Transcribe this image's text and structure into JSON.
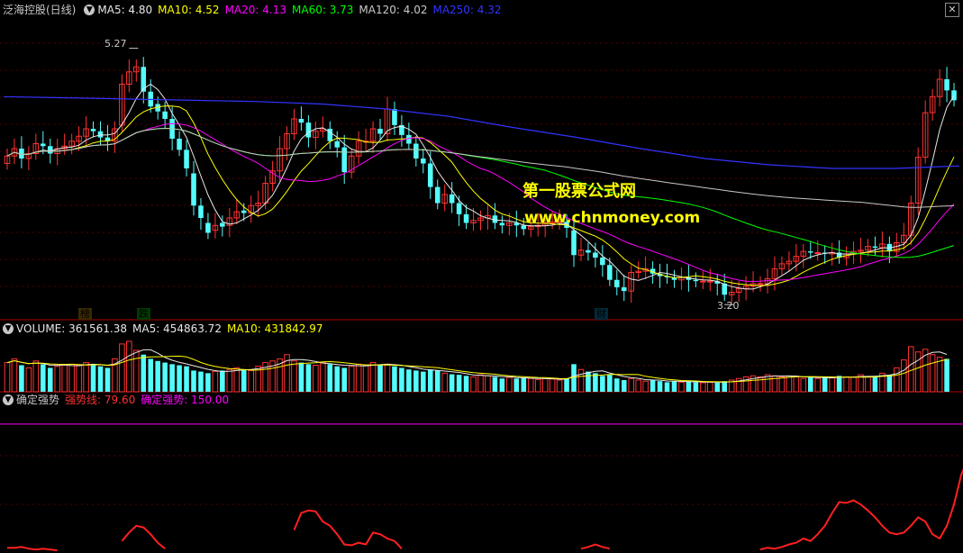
{
  "main_legend": {
    "title": "泛海控股(日线)",
    "items": [
      {
        "text": "MA5: 4.80",
        "color": "#e8e8e8"
      },
      {
        "text": "MA10: 4.52",
        "color": "#ffff00"
      },
      {
        "text": "MA20: 4.13",
        "color": "#ff00ff"
      },
      {
        "text": "MA60: 3.73",
        "color": "#00ff00"
      },
      {
        "text": "MA120: 4.02",
        "color": "#c8c8c8"
      },
      {
        "text": "MA250: 4.32",
        "color": "#3333ff"
      }
    ]
  },
  "volume_legend": {
    "items": [
      {
        "text": "VOLUME: 361561.38",
        "color": "#e8e8e8"
      },
      {
        "text": "MA5: 454863.72",
        "color": "#e8e8e8"
      },
      {
        "text": "MA10: 431842.97",
        "color": "#ffff00"
      }
    ]
  },
  "indicator_legend": {
    "title": "确定强势",
    "items": [
      {
        "text": "强势线: 79.60",
        "color": "#ff3030"
      },
      {
        "text": "确定强势: 150.00",
        "color": "#ff00ff"
      }
    ]
  },
  "watermark": {
    "line1": "第一股票公式网",
    "line2": "www.chnmoney.com"
  },
  "annotations": {
    "high": "5.27",
    "low": "3.20"
  },
  "event_marks": [
    {
      "text": "榜",
      "color": "#ffa040"
    },
    {
      "text": "跌",
      "color": "#00ff00"
    },
    {
      "text": "财",
      "color": "#00ffff"
    }
  ],
  "chart_data": [
    {
      "type": "candlestick",
      "ylim": [
        3.1,
        5.5
      ],
      "grid": true,
      "closes": [
        4.4,
        4.46,
        4.38,
        4.42,
        4.5,
        4.48,
        4.42,
        4.46,
        4.48,
        4.52,
        4.56,
        4.62,
        4.6,
        4.55,
        4.52,
        4.62,
        4.98,
        5.08,
        5.12,
        4.92,
        4.8,
        4.76,
        4.7,
        4.54,
        4.45,
        4.3,
        4.0,
        3.9,
        3.78,
        3.84,
        3.83,
        3.9,
        3.95,
        3.94,
        4.0,
        4.02,
        4.18,
        4.28,
        4.46,
        4.58,
        4.7,
        4.67,
        4.55,
        4.6,
        4.62,
        4.52,
        4.47,
        4.27,
        4.4,
        4.52,
        4.52,
        4.62,
        4.58,
        4.78,
        4.65,
        4.57,
        4.5,
        4.38,
        4.34,
        4.15,
        4.02,
        4.09,
        4.02,
        3.93,
        3.86,
        3.88,
        3.9,
        3.92,
        3.86,
        3.84,
        3.86,
        3.84,
        3.81,
        3.83,
        3.84,
        3.86,
        3.87,
        3.87,
        3.82,
        3.6,
        3.64,
        3.62,
        3.58,
        3.52,
        3.4,
        3.34,
        3.31,
        3.46,
        3.47,
        3.49,
        3.45,
        3.43,
        3.42,
        3.4,
        3.42,
        3.4,
        3.39,
        3.39,
        3.39,
        3.37,
        3.28,
        3.3,
        3.33,
        3.35,
        3.37,
        3.37,
        3.41,
        3.49,
        3.53,
        3.55,
        3.59,
        3.63,
        3.62,
        3.62,
        3.61,
        3.62,
        3.58,
        3.61,
        3.63,
        3.64,
        3.67,
        3.66,
        3.69,
        3.63,
        3.7,
        3.76,
        4.02,
        4.39,
        4.75,
        4.88,
        5.02,
        4.93,
        4.85
      ],
      "opens": [
        4.34,
        4.4,
        4.46,
        4.38,
        4.42,
        4.5,
        4.48,
        4.42,
        4.46,
        4.48,
        4.52,
        4.56,
        4.62,
        4.6,
        4.55,
        4.52,
        4.65,
        4.98,
        5.08,
        5.12,
        4.92,
        4.82,
        4.76,
        4.7,
        4.54,
        4.45,
        4.26,
        4.0,
        3.86,
        3.8,
        3.86,
        3.84,
        3.9,
        3.96,
        3.94,
        4.0,
        4.02,
        4.18,
        4.28,
        4.46,
        4.58,
        4.7,
        4.67,
        4.55,
        4.6,
        4.62,
        4.52,
        4.47,
        4.27,
        4.4,
        4.52,
        4.52,
        4.62,
        4.58,
        4.78,
        4.65,
        4.57,
        4.5,
        4.38,
        4.34,
        4.15,
        4.02,
        4.09,
        4.02,
        3.93,
        3.86,
        3.88,
        3.9,
        3.92,
        3.86,
        3.84,
        3.86,
        3.84,
        3.81,
        3.83,
        3.84,
        3.86,
        3.87,
        3.87,
        3.8,
        3.6,
        3.64,
        3.62,
        3.58,
        3.52,
        3.4,
        3.34,
        3.31,
        3.46,
        3.47,
        3.49,
        3.45,
        3.43,
        3.42,
        3.4,
        3.42,
        3.4,
        3.39,
        3.39,
        3.39,
        3.37,
        3.28,
        3.3,
        3.33,
        3.35,
        3.37,
        3.37,
        3.41,
        3.49,
        3.53,
        3.55,
        3.59,
        3.63,
        3.62,
        3.62,
        3.61,
        3.62,
        3.58,
        3.61,
        3.63,
        3.64,
        3.67,
        3.66,
        3.69,
        3.63,
        3.7,
        3.76,
        4.02,
        4.39,
        4.75,
        4.88,
        5.02,
        4.93
      ],
      "high": 5.27,
      "low": 3.2,
      "ma_series": [
        {
          "name": "MA5",
          "color": "#e8e8e8"
        },
        {
          "name": "MA10",
          "color": "#ffff00"
        },
        {
          "name": "MA20",
          "color": "#ff00ff"
        },
        {
          "name": "MA60",
          "color": "#00ff00"
        },
        {
          "name": "MA120",
          "color": "#c8c8c8"
        },
        {
          "name": "MA250",
          "color": "#3333ff"
        }
      ],
      "ma250": [
        4.88,
        4.87,
        4.86,
        4.85,
        4.84,
        4.82,
        4.78,
        4.72,
        4.63,
        4.55,
        4.46,
        4.38,
        4.33,
        4.3,
        4.3,
        4.32
      ]
    },
    {
      "type": "bar",
      "series": [
        {
          "name": "VOLUME"
        },
        {
          "name": "MA5"
        },
        {
          "name": "MA10"
        }
      ],
      "values": [
        0.55,
        0.62,
        0.5,
        0.45,
        0.58,
        0.52,
        0.45,
        0.48,
        0.5,
        0.52,
        0.5,
        0.55,
        0.52,
        0.48,
        0.45,
        0.62,
        0.9,
        0.95,
        0.78,
        0.7,
        0.62,
        0.58,
        0.55,
        0.52,
        0.5,
        0.48,
        0.4,
        0.38,
        0.35,
        0.38,
        0.4,
        0.42,
        0.45,
        0.42,
        0.4,
        0.48,
        0.55,
        0.58,
        0.62,
        0.7,
        0.58,
        0.55,
        0.52,
        0.5,
        0.55,
        0.52,
        0.48,
        0.45,
        0.48,
        0.52,
        0.5,
        0.55,
        0.5,
        0.52,
        0.48,
        0.45,
        0.42,
        0.4,
        0.38,
        0.42,
        0.4,
        0.35,
        0.33,
        0.32,
        0.3,
        0.28,
        0.32,
        0.3,
        0.28,
        0.25,
        0.27,
        0.25,
        0.26,
        0.25,
        0.23,
        0.25,
        0.24,
        0.22,
        0.25,
        0.52,
        0.42,
        0.38,
        0.35,
        0.3,
        0.32,
        0.25,
        0.22,
        0.25,
        0.22,
        0.2,
        0.22,
        0.2,
        0.18,
        0.2,
        0.18,
        0.2,
        0.18,
        0.17,
        0.18,
        0.17,
        0.2,
        0.22,
        0.25,
        0.28,
        0.3,
        0.28,
        0.32,
        0.3,
        0.28,
        0.3,
        0.28,
        0.25,
        0.27,
        0.25,
        0.28,
        0.26,
        0.3,
        0.28,
        0.27,
        0.32,
        0.28,
        0.3,
        0.35,
        0.32,
        0.45,
        0.6,
        0.85,
        0.75,
        0.8,
        0.7,
        0.65,
        0.62
      ]
    },
    {
      "type": "line",
      "series": [
        {
          "name": "强势线"
        },
        {
          "name": "确定强势",
          "constant": 150.0
        }
      ],
      "ylim": [
        0,
        170
      ],
      "values": [
        4,
        4,
        5,
        3,
        2,
        3,
        2,
        1,
        0,
        0,
        0,
        0,
        0,
        0,
        0,
        0,
        12,
        22,
        30,
        28,
        20,
        10,
        3,
        0,
        0,
        0,
        0,
        0,
        0,
        0,
        0,
        0,
        0,
        0,
        0,
        0,
        0,
        0,
        0,
        0,
        25,
        45,
        48,
        47,
        35,
        30,
        20,
        8,
        7,
        10,
        8,
        22,
        20,
        15,
        12,
        3,
        0,
        0,
        0,
        0,
        0,
        0,
        0,
        0,
        0,
        0,
        0,
        0,
        0,
        0,
        0,
        0,
        0,
        0,
        0,
        0,
        0,
        0,
        0,
        0,
        3,
        5,
        8,
        5,
        3,
        0,
        0,
        0,
        0,
        0,
        0,
        0,
        0,
        0,
        0,
        0,
        0,
        0,
        0,
        0,
        0,
        0,
        0,
        0,
        0,
        2,
        4,
        3,
        5,
        8,
        10,
        15,
        12,
        20,
        30,
        45,
        58,
        57,
        60,
        55,
        48,
        40,
        30,
        22,
        20,
        22,
        30,
        40,
        35,
        20,
        15,
        30,
        55,
        90,
        110,
        120,
        118,
        100,
        79.6
      ]
    }
  ]
}
